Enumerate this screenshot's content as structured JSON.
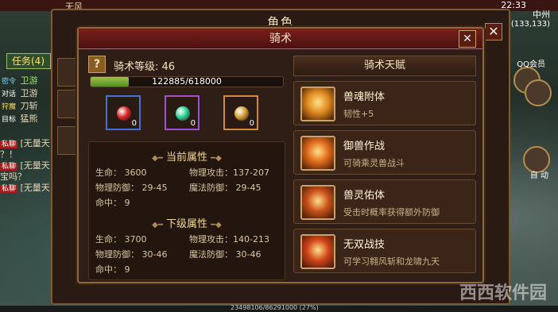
{
  "hud": {
    "top_name": "无风",
    "clock": "22:33",
    "region": "中州",
    "coords": "(133,133)",
    "qq_label": "QQ会员",
    "auto_label": "自 动",
    "exp_text": "23498106/86291000 (27%)"
  },
  "left": {
    "quest_label": "任务(4)",
    "chat": [
      {
        "tag": "密令",
        "text": "卫游"
      },
      {
        "tag": "对话",
        "text": "卫游"
      },
      {
        "tag": "狩魔",
        "text": "刀斩"
      },
      {
        "tag": "目标",
        "text": "猛熊"
      },
      {
        "tag": "私聊",
        "text": "[无量天"
      },
      {
        "tag": "",
        "text": "？！"
      },
      {
        "tag": "私聊",
        "text": "[无量天"
      },
      {
        "tag": "",
        "text": "宝吗？"
      },
      {
        "tag": "私聊",
        "text": "[无量天"
      }
    ]
  },
  "role_window": {
    "title": "角色",
    "close": "✕"
  },
  "panel": {
    "title": "骑术",
    "close": "✕",
    "help": "?",
    "level_label": "骑术等级: 46",
    "exp_text": "122885/618000",
    "exp_fraction": 0.199,
    "gems": [
      {
        "color": "#d62a2a",
        "border": "#4a6fd4",
        "count": "0"
      },
      {
        "color": "#2ed19a",
        "border": "#a24fd0",
        "count": "0"
      },
      {
        "color": "#d4a030",
        "border": "#d4863a",
        "count": "0"
      }
    ],
    "current": {
      "title": "当前属性",
      "hp": "生命：  3600",
      "patk": "物理攻击：137-207",
      "pdef": "物理防御：  29-45",
      "mdef": "魔法防御：  29-45",
      "hit": "命中：  9"
    },
    "next": {
      "title": "下级属性",
      "hp": "生命：  3700",
      "patk": "物理攻击：140-213",
      "pdef": "物理防御：  30-46",
      "mdef": "魔法防御：  30-46",
      "hit": "命中：  9"
    },
    "talent_title": "骑术天赋",
    "talents": [
      {
        "name": "兽魂附体",
        "desc": "韧性+5",
        "icon_color": "#e08a1e"
      },
      {
        "name": "御兽作战",
        "desc": "可骑乘灵兽战斗",
        "icon_color": "#e06a1a"
      },
      {
        "name": "兽灵佑体",
        "desc": "受击时概率获得额外防御",
        "icon_color": "#c8501a"
      },
      {
        "name": "无双战技",
        "desc": "可学习翱风斩和龙啸九天",
        "icon_color": "#d24418"
      }
    ]
  },
  "watermark": "西西软件园"
}
